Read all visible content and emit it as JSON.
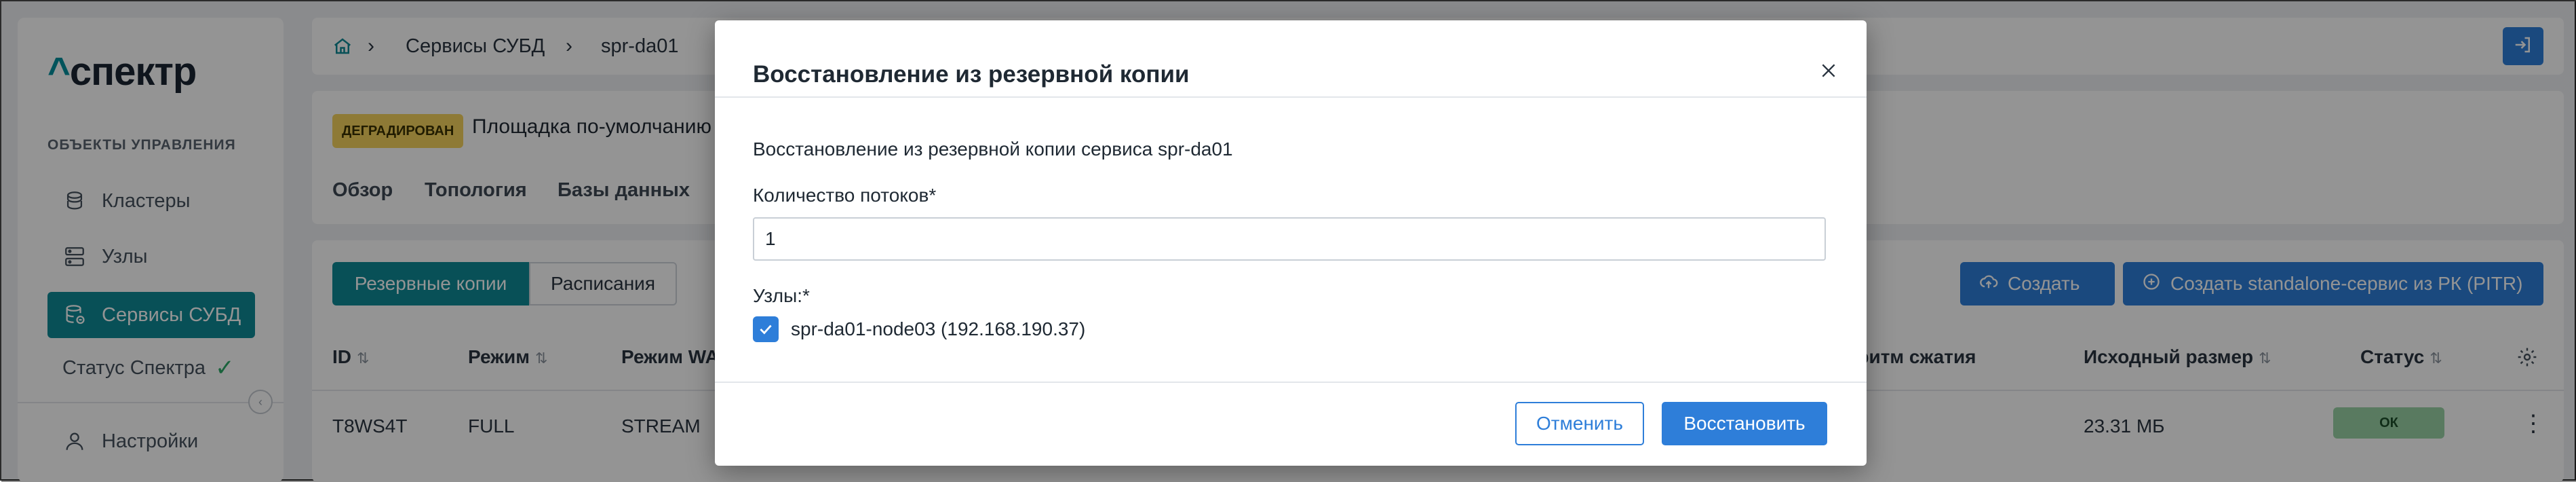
{
  "app": {
    "logo_caret": "^",
    "logo_text": "спектр"
  },
  "sidebar": {
    "section_title": "ОБЪЕКТЫ УПРАВЛЕНИЯ",
    "items": [
      {
        "label": "Кластеры",
        "icon": "clusters-icon"
      },
      {
        "label": "Узлы",
        "icon": "server-icon"
      },
      {
        "label": "Сервисы СУБД",
        "icon": "database-icon",
        "active": true
      }
    ],
    "status_label": "Статус Спектра",
    "settings_label": "Настройки"
  },
  "breadcrumb": {
    "home_icon": "home-icon",
    "items": [
      "Сервисы СУБД",
      "spr-da01"
    ]
  },
  "service": {
    "status_badge": "ДЕГРАДИРОВАН",
    "title": "Площадка по-умолчанию /",
    "tabs": [
      "Обзор",
      "Топология",
      "Базы данных"
    ]
  },
  "backups": {
    "segment_on": "Резервные копии",
    "segment_off": "Расписания",
    "create_button": "Создать",
    "pitr_button": "Создать standalone-сервис из РК (PITR)",
    "columns": {
      "id": "ID",
      "mode": "Режим",
      "wal_mode": "Режим WA",
      "compression": "горитм сжатия",
      "size": "Исходный размер",
      "status": "Статус"
    },
    "row": {
      "id": "T8WS4T",
      "mode": "FULL",
      "wal_mode": "STREAM",
      "size": "23.31 МБ",
      "status": "ОК"
    }
  },
  "modal": {
    "title": "Восстановление из резервной копии",
    "description": "Восстановление из резервной копии сервиса spr-da01",
    "threads_label": "Количество потоков*",
    "threads_value": "1",
    "nodes_label": "Узлы:*",
    "node_option": "spr-da01-node03 (192.168.190.37)",
    "node_checked": true,
    "cancel_button": "Отменить",
    "restore_button": "Восстановить"
  },
  "colors": {
    "teal": "#0f8a96",
    "blue": "#2e7ed9",
    "degraded": "#f5d25e",
    "ok": "#9ad2a6"
  }
}
